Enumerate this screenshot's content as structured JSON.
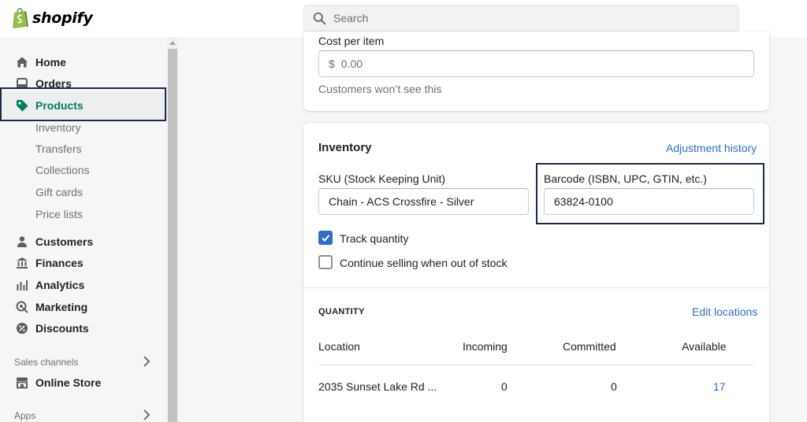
{
  "brand": {
    "name": "shopify",
    "color": "#95bf47"
  },
  "search": {
    "placeholder": "Search"
  },
  "sidebar": {
    "items": [
      {
        "label": "Home",
        "icon": "home-icon"
      },
      {
        "label": "Orders",
        "icon": "orders-icon"
      },
      {
        "label": "Products",
        "icon": "tag-icon",
        "active": true
      },
      {
        "label": "Customers",
        "icon": "person-icon"
      },
      {
        "label": "Finances",
        "icon": "bank-icon"
      },
      {
        "label": "Analytics",
        "icon": "bar-chart-icon"
      },
      {
        "label": "Marketing",
        "icon": "target-icon"
      },
      {
        "label": "Discounts",
        "icon": "discount-icon"
      }
    ],
    "product_subitems": [
      "Inventory",
      "Transfers",
      "Collections",
      "Gift cards",
      "Price lists"
    ],
    "sales_channels_label": "Sales channels",
    "online_store_label": "Online Store",
    "apps_label": "Apps"
  },
  "pricing": {
    "cost_label": "Cost per item",
    "currency_symbol": "$",
    "cost_value": "0.00",
    "cost_help": "Customers won’t see this"
  },
  "inventory": {
    "title": "Inventory",
    "history_link": "Adjustment history",
    "sku_label": "SKU (Stock Keeping Unit)",
    "sku_value": "Chain - ACS Crossfire - Silver",
    "barcode_label": "Barcode (ISBN, UPC, GTIN, etc.)",
    "barcode_value": "63824-0100",
    "track_quantity_label": "Track quantity",
    "track_quantity_checked": true,
    "continue_selling_label": "Continue selling when out of stock",
    "continue_selling_checked": false
  },
  "quantity": {
    "heading": "QUANTITY",
    "edit_link": "Edit locations",
    "columns": [
      "Location",
      "Incoming",
      "Committed",
      "Available"
    ],
    "rows": [
      {
        "location": "2035 Sunset Lake Rd ...",
        "incoming": "0",
        "committed": "0",
        "available": "17"
      }
    ]
  },
  "colors": {
    "accent_green": "#007f5f",
    "link_blue": "#2c6ecb",
    "highlight_navy": "#1a2c4d"
  }
}
